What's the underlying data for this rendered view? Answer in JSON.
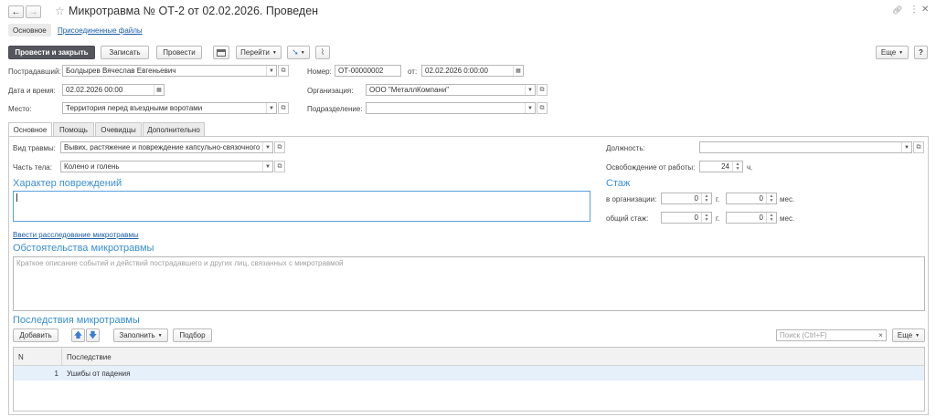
{
  "window": {
    "title": "Микротравма № ОТ-2 от 02.02.2026. Проведен"
  },
  "nav_tabs": {
    "main": "Основное",
    "files": "Присоединенные файлы"
  },
  "toolbar": {
    "post_close": "Провести и закрыть",
    "save": "Записать",
    "post": "Провести",
    "goto": "Перейти",
    "more": "Еще",
    "help": "?"
  },
  "header": {
    "victim_label": "Пострадавший:",
    "victim_value": "Болдырев Вячеслав Евгеньевич",
    "number_label": "Номер:",
    "number_value": "ОТ-00000002",
    "date_from_label": "от:",
    "date_from_value": "02.02.2026  0:00:00",
    "datetime_label": "Дата и время:",
    "datetime_value": "02.02.2026 00:00",
    "org_label": "Организация:",
    "org_value": "ООО \"МеталлКомпани\"",
    "place_label": "Место:",
    "place_value": "Территория перед въездными воротами",
    "dept_label": "Подразделение:",
    "dept_value": ""
  },
  "tabs": [
    "Основное",
    "Помощь",
    "Очевидцы",
    "Дополнительно"
  ],
  "main": {
    "injury_type_label": "Вид травмы:",
    "injury_type_value": "Вывих, растяжение и повреждение капсульно-связочного",
    "body_part_label": "Часть тела:",
    "body_part_value": "Колено и голень",
    "position_label": "Должность:",
    "position_value": "",
    "release_label": "Освобождение от работы:",
    "release_value": "24",
    "release_unit": "ч.",
    "damage_title": "Характер повреждений",
    "damage_value": "",
    "investigation_link": "Ввести расследование микротравмы",
    "circumstances_title": "Обстоятельства микротравмы",
    "circumstances_placeholder": "Краткое описание событий и действий пострадавшего и других лиц, связанных с микротравмой",
    "consequences_title": "Последствия микротравмы"
  },
  "experience": {
    "title": "Стаж",
    "org_label": "в организации:",
    "total_label": "общий стаж:",
    "org_years": "0",
    "org_months": "0",
    "total_years": "0",
    "total_months": "0",
    "years_unit": "г.",
    "months_unit": "мес."
  },
  "table_toolbar": {
    "add": "Добавить",
    "fill": "Заполнить",
    "pick": "Подбор",
    "search_placeholder": "Поиск (Ctrl+F)",
    "more": "Еще"
  },
  "table": {
    "columns": [
      "N",
      "Последствие"
    ],
    "rows": [
      {
        "n": "1",
        "value": "Ушибы от падения"
      }
    ]
  },
  "colors": {
    "accent": "#3a8fd1",
    "primary_button": "#55555d",
    "selected_row": "#e6f0fb"
  }
}
